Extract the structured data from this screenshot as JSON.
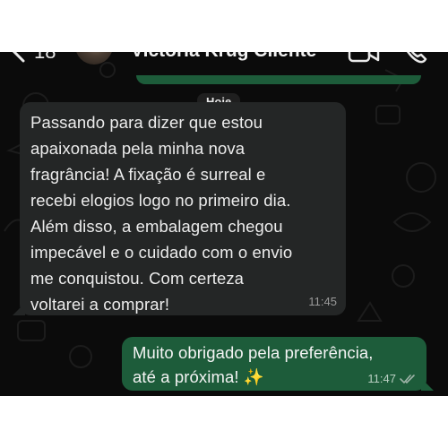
{
  "header": {
    "unread_count": "18",
    "contact_name": "Victoria Krug Cliente"
  },
  "chat": {
    "date_label": "Hoje",
    "messages": [
      {
        "direction": "incoming",
        "text": "Passando para dizer que estou\napaixonada pela minha nova\nfragrância! A fixação é surreal e\nrecebi elogios logo no primeiro dia.\nAlém disso, a embalagem chegou\nimpecável e o cuidado com o envio\nme conquistou. Com certeza\nvoltarei a comprar!",
        "time": "11:45"
      },
      {
        "direction": "outgoing",
        "text": "Muito obrigado pela preferência,\naté a próxima! ✨",
        "time": "11:47",
        "status_icon": "double-check-read-icon"
      }
    ]
  },
  "colors": {
    "background": "#0b0b0b",
    "incoming_bubble": "#242626",
    "outgoing_bubble": "#1d5c3a",
    "read_ticks": "#9fb3a8"
  },
  "icons": [
    "back-chevron-icon",
    "video-call-icon",
    "phone-call-icon",
    "sparkles-emoji"
  ]
}
